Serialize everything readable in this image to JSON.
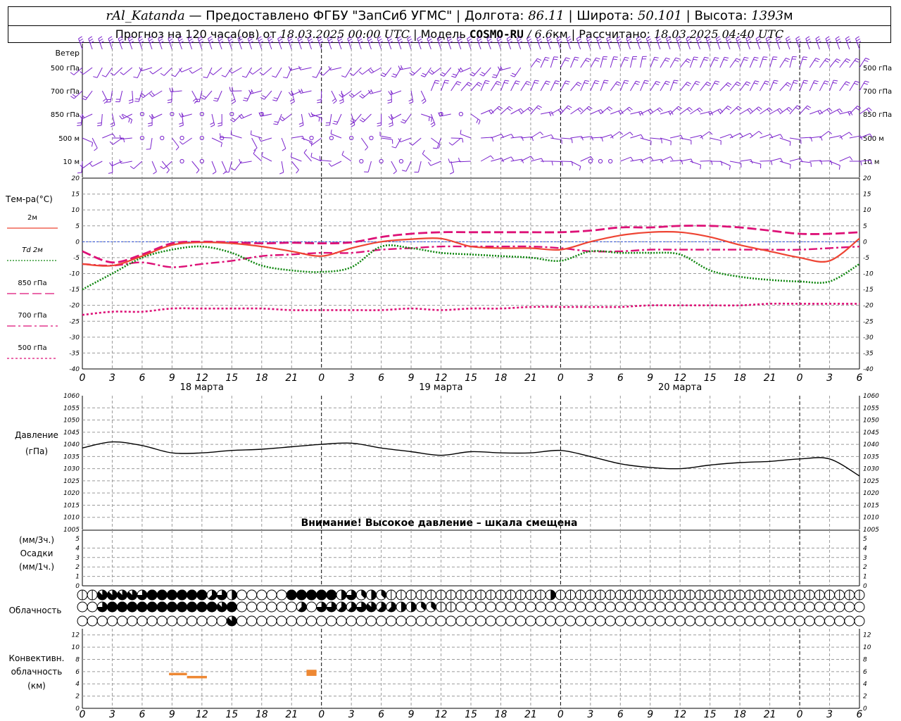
{
  "header": {
    "station": "rAl_Katanda",
    "dash": " — ",
    "provider": "Предоставлено ФГБУ \"ЗапСиб УГМС\"",
    "sep": " | ",
    "lon_label": "Долгота: ",
    "lon": "86.11",
    "lat_label": "Широта: ",
    "lat": "50.101",
    "alt_label": "Высота: ",
    "alt": "1393",
    "alt_unit": "м",
    "forecast_label": "Прогноз на 120 часа(ов) от ",
    "forecast_from": "18.03.2025 00:00 UTC",
    "model_label": "Модель ",
    "model": "COSMO-RU",
    "model_res": " / 6.6",
    "model_res_unit": "км",
    "calc_label": "Рассчитано: ",
    "calc_time": "18.03.2025 04:40 UTC"
  },
  "chart_data": [
    {
      "id": "wind",
      "type": "barbs",
      "title": "Ветер",
      "levels": [
        "500 гПа",
        "700 гПа",
        "850 гПа",
        "500 м",
        "10  м"
      ]
    },
    {
      "id": "temperature",
      "type": "line",
      "title": "Тем-ра(°C)",
      "ylim": [
        -40,
        20
      ],
      "yticks": [
        20,
        15,
        10,
        5,
        0,
        -5,
        -10,
        -15,
        -20,
        -25,
        -30,
        -35,
        -40
      ],
      "x_hours": [
        0,
        3,
        6,
        9,
        12,
        15,
        18,
        21,
        24,
        27,
        30,
        33,
        36,
        39,
        42,
        45,
        48,
        51,
        54,
        57,
        60,
        63,
        66,
        69,
        72,
        75,
        78
      ],
      "series": [
        {
          "name": "2м",
          "color": "#ee4433",
          "dash": "solid",
          "values": [
            -7,
            -7.5,
            -4.5,
            -1,
            -0.2,
            -0.5,
            -1.5,
            -3,
            -4.5,
            -2,
            0,
            0.8,
            1,
            -1.5,
            -2,
            -2,
            -2.5,
            0,
            2,
            3,
            3,
            1.5,
            -1,
            -3,
            -5,
            -6,
            1
          ]
        },
        {
          "name": "Td  2м",
          "color": "#118811",
          "dash": "dot",
          "values": [
            -15,
            -10,
            -5,
            -2.5,
            -1.5,
            -3.5,
            -7.5,
            -9,
            -9.5,
            -8,
            -1.5,
            -2,
            -3.5,
            -4,
            -4.5,
            -5,
            -6,
            -3,
            -3.5,
            -3.5,
            -4,
            -9,
            -11,
            -12,
            -12.5,
            -12.5,
            -7
          ]
        },
        {
          "name": "850 гПа",
          "color": "#dd1177",
          "dash": "longdash",
          "values": [
            -3,
            -6.5,
            -4,
            -0.5,
            0,
            -0.2,
            -0.5,
            -0.3,
            -0.5,
            -0.2,
            1.5,
            2.5,
            3,
            3,
            3,
            3,
            3,
            3.5,
            4.5,
            4.5,
            5,
            5,
            4.5,
            3.5,
            2.5,
            2.5,
            3
          ]
        },
        {
          "name": "700 гПа",
          "color": "#dd1177",
          "dash": "dashdot",
          "values": [
            -7,
            -7.5,
            -6.5,
            -8,
            -7,
            -6,
            -4.5,
            -4,
            -3.5,
            -3.5,
            -2.5,
            -2,
            -1.5,
            -1.5,
            -1.5,
            -1.5,
            -2,
            -3,
            -3,
            -2.5,
            -2.5,
            -2.5,
            -2.5,
            -2.5,
            -2.5,
            -2,
            -1.5
          ]
        },
        {
          "name": "500 гПа",
          "color": "#dd1177",
          "dash": "shortdash",
          "values": [
            -23,
            -22,
            -22,
            -21,
            -21,
            -21,
            -21,
            -21.5,
            -21.5,
            -21.5,
            -21.5,
            -21,
            -21.5,
            -21,
            -21,
            -20.5,
            -20.5,
            -20.5,
            -20.5,
            -20,
            -20,
            -20,
            -20,
            -19.5,
            -19.5,
            -19.5,
            -19.5
          ]
        }
      ]
    },
    {
      "id": "pressure",
      "type": "line",
      "title": "Давление",
      "unit": "(гПа)",
      "ylim": [
        1005,
        1060
      ],
      "yticks": [
        1060,
        1055,
        1050,
        1045,
        1040,
        1035,
        1030,
        1025,
        1020,
        1015,
        1010,
        1005
      ],
      "warning": "Внимание! Высокое давление – шкала смещена",
      "x_hours": [
        0,
        3,
        6,
        9,
        12,
        15,
        18,
        21,
        24,
        27,
        30,
        33,
        36,
        39,
        42,
        45,
        48,
        51,
        54,
        57,
        60,
        63,
        66,
        69,
        72,
        75,
        78
      ],
      "series": [
        {
          "name": "",
          "color": "#000000",
          "values": [
            1038.5,
            1041,
            1039.5,
            1036.5,
            1036.5,
            1037.5,
            1038,
            1039,
            1040,
            1040.5,
            1038.5,
            1037,
            1035.5,
            1037,
            1036.5,
            1036.5,
            1037.5,
            1035,
            1032,
            1030.5,
            1030,
            1031.5,
            1032.5,
            1033,
            1034,
            1034,
            1027
          ]
        }
      ]
    },
    {
      "id": "precip",
      "type": "bar",
      "title": "Осадки",
      "unit_top": "(мм/3ч.)",
      "unit_bottom": "(мм/1ч.)",
      "ylim": [
        0,
        5
      ],
      "yticks": [
        5,
        4,
        3,
        2,
        1,
        0
      ],
      "values": []
    },
    {
      "id": "clouds",
      "type": "symbols",
      "title": "Облачность",
      "x_hours": [
        0,
        1,
        2,
        3,
        4,
        5,
        6,
        7,
        8,
        9,
        10,
        11,
        12,
        13,
        14,
        15,
        16,
        17,
        18,
        19,
        20,
        21,
        22,
        23,
        24,
        25,
        26,
        27,
        28,
        29,
        30,
        31,
        32,
        33,
        34,
        35,
        36,
        37,
        38,
        39,
        40,
        41,
        42,
        43,
        44,
        45,
        46,
        47,
        48,
        49,
        50,
        51,
        52,
        53,
        54,
        55,
        56,
        57,
        58,
        59,
        60,
        61,
        62,
        63,
        64,
        65,
        66,
        67,
        68,
        69,
        70,
        71,
        72,
        73,
        74,
        75,
        76,
        77,
        78
      ],
      "rows": [
        {
          "name": "upper",
          "values": [
            2,
            2,
            7,
            7,
            7,
            7,
            6,
            8,
            8,
            8,
            8,
            8,
            8,
            5,
            6,
            4,
            0,
            0,
            0,
            0,
            0,
            8,
            8,
            8,
            8,
            8,
            4,
            6,
            3,
            4,
            3,
            2,
            2,
            2,
            2,
            2,
            2,
            2,
            2,
            2,
            2,
            2,
            2,
            2,
            2,
            2,
            2,
            4,
            2,
            2,
            2,
            2,
            2,
            2,
            2,
            2,
            2,
            2,
            2,
            2,
            2,
            2,
            2,
            2,
            2,
            2,
            2,
            2,
            2,
            2,
            2,
            2,
            2,
            2,
            2,
            2,
            2,
            2,
            2
          ]
        },
        {
          "name": "middle",
          "values": [
            0,
            0,
            6,
            8,
            8,
            8,
            8,
            8,
            8,
            8,
            8,
            8,
            8,
            8,
            7,
            8,
            0,
            0,
            0,
            0,
            0,
            0,
            5,
            0,
            6,
            6,
            5,
            5,
            6,
            7,
            5,
            5,
            4,
            4,
            3,
            3,
            2,
            2,
            0,
            0,
            0,
            0,
            0,
            0,
            0,
            0,
            0,
            0,
            0,
            0,
            0,
            0,
            0,
            0,
            0,
            0,
            0,
            0,
            0,
            0,
            0,
            0,
            0,
            0,
            0,
            0,
            0,
            0,
            0,
            0,
            0,
            0,
            0,
            0,
            0,
            0,
            0,
            0,
            0
          ]
        },
        {
          "name": "lower",
          "values": [
            0,
            0,
            0,
            0,
            0,
            0,
            0,
            0,
            0,
            0,
            0,
            0,
            0,
            0,
            0,
            7,
            0,
            0,
            0,
            0,
            0,
            0,
            0,
            0,
            0,
            0,
            0,
            0,
            0,
            0,
            0,
            0,
            0,
            0,
            0,
            0,
            0,
            0,
            0,
            0,
            0,
            0,
            0,
            0,
            0,
            0,
            0,
            0,
            0,
            0,
            0,
            0,
            0,
            0,
            0,
            0,
            0,
            0,
            0,
            0,
            0,
            0,
            0,
            0,
            0,
            0,
            0,
            0,
            0,
            0,
            0,
            0,
            0,
            0,
            0,
            0,
            0,
            0,
            0
          ]
        }
      ]
    },
    {
      "id": "convective",
      "type": "bar",
      "title": "Конвективн.",
      "title2": "облачность",
      "unit": "(км)",
      "ylim": [
        0,
        13
      ],
      "yticks": [
        12,
        10,
        8,
        6,
        4,
        2,
        0
      ],
      "color": "#ee8833",
      "segments": [
        {
          "h0": 8.7,
          "h1": 10.5,
          "bottom": 5.4,
          "top": 5.8
        },
        {
          "h0": 10.5,
          "h1": 12.5,
          "bottom": 4.9,
          "top": 5.3
        },
        {
          "h0": 22.5,
          "h1": 23.5,
          "bottom": 5.3,
          "top": 6.3
        }
      ]
    }
  ],
  "x_axis": {
    "tick_labels": [
      "0",
      "3",
      "6",
      "9",
      "12",
      "15",
      "18",
      "21",
      "0",
      "3",
      "6",
      "9",
      "12",
      "15",
      "18",
      "21",
      "0",
      "3",
      "6",
      "9",
      "12",
      "15",
      "18",
      "21",
      "0",
      "3",
      "6"
    ],
    "dates": [
      "18 марта",
      "19 марта",
      "20 марта"
    ]
  }
}
